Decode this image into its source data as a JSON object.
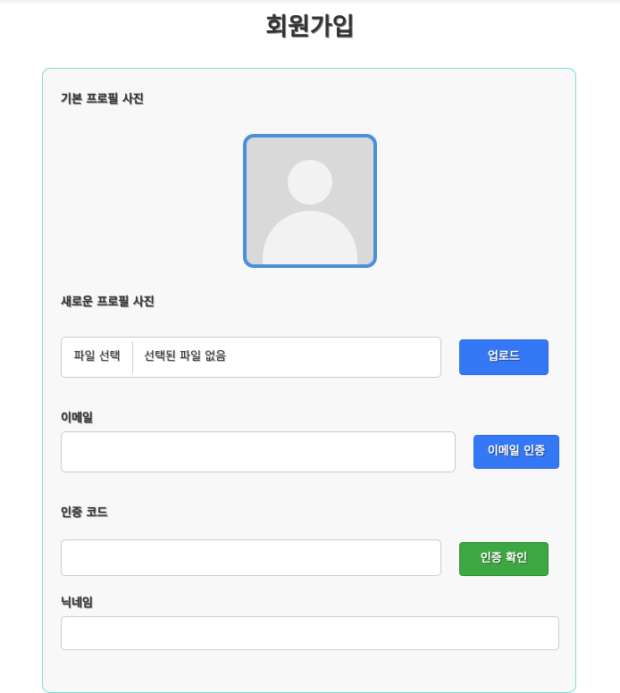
{
  "page": {
    "title": "회원가입"
  },
  "profile": {
    "default_label": "기본 프로필 사진",
    "new_label": "새로운 프로필 사진",
    "file_button": "파일 선택",
    "file_status": "선택된 파일 없음",
    "upload_button": "업로드"
  },
  "email": {
    "label": "이메일",
    "value": "",
    "verify_button": "이메일 인증"
  },
  "code": {
    "label": "인증 코드",
    "value": "",
    "confirm_button": "인증 확인"
  },
  "nickname": {
    "label": "닉네임",
    "value": ""
  },
  "colors": {
    "accent_blue": "#3478f6",
    "confirm_green": "#3da741",
    "avatar_border": "#4a90d9",
    "card_border": "#7fdcd2"
  }
}
